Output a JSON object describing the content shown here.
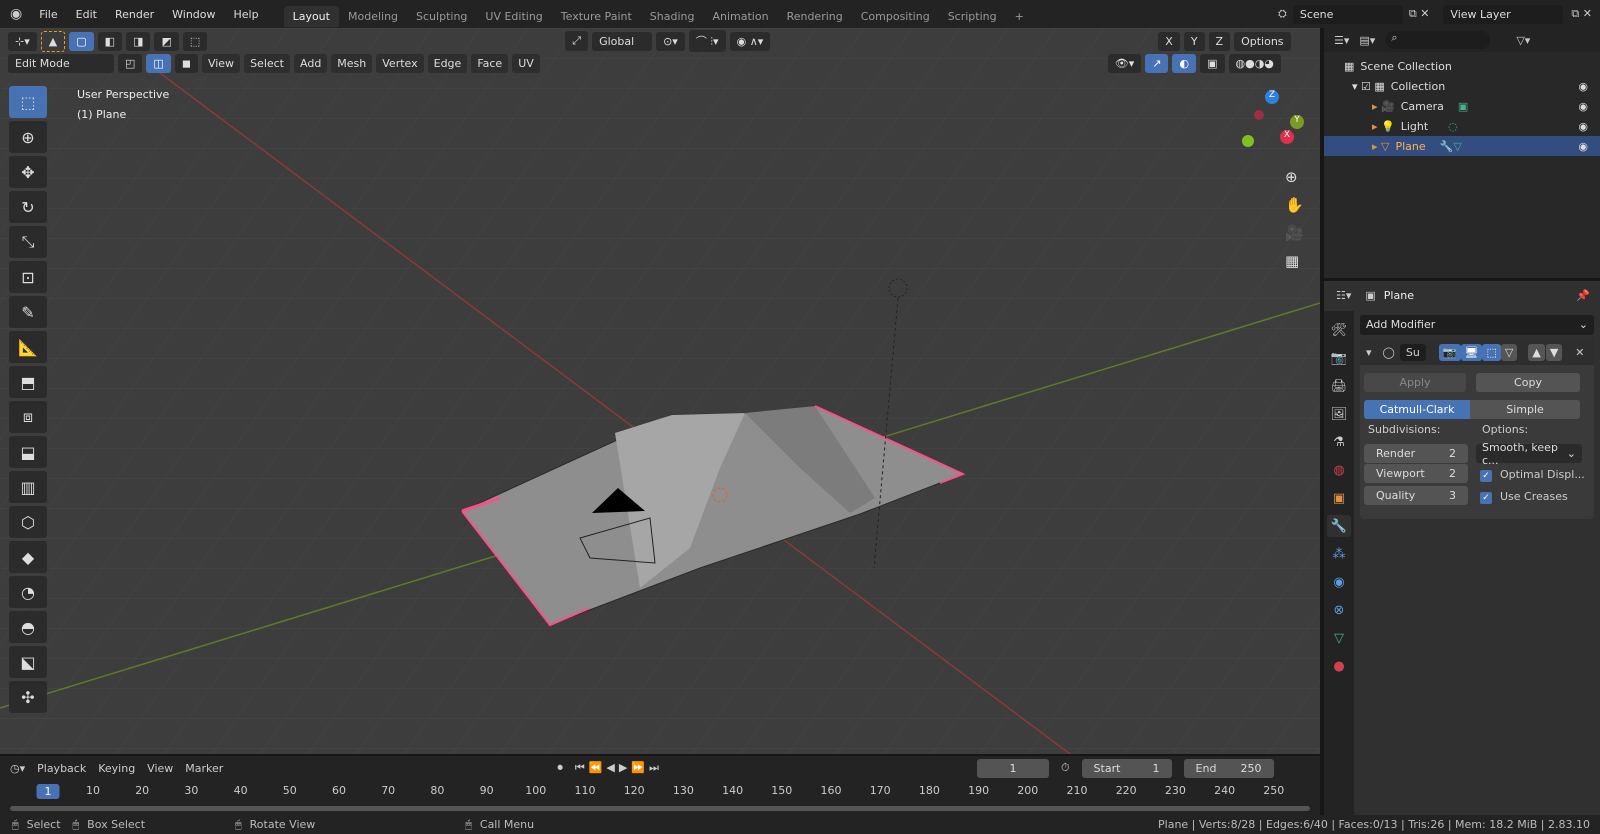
{
  "topbar": {
    "menus": [
      "File",
      "Edit",
      "Render",
      "Window",
      "Help"
    ],
    "tabs": [
      "Layout",
      "Modeling",
      "Sculpting",
      "UV Editing",
      "Texture Paint",
      "Shading",
      "Animation",
      "Rendering",
      "Compositing",
      "Scripting"
    ],
    "scene": "Scene",
    "view_layer": "View Layer"
  },
  "viewport": {
    "orientation": "Global",
    "options": "Options",
    "mode": "Edit Mode",
    "menus": [
      "View",
      "Select",
      "Add",
      "Mesh",
      "Vertex",
      "Edge",
      "Face",
      "UV"
    ],
    "overlay_title": "User Perspective",
    "overlay_object": "(1) Plane",
    "axes": [
      "X",
      "Y",
      "Z"
    ]
  },
  "outliner": {
    "root": "Scene Collection",
    "collection": "Collection",
    "items": [
      "Camera",
      "Light",
      "Plane"
    ]
  },
  "properties": {
    "object": "Plane",
    "add_modifier": "Add Modifier",
    "modifier_name": "Su",
    "apply": "Apply",
    "copy": "Copy",
    "types": [
      "Catmull-Clark",
      "Simple"
    ],
    "subdivisions_label": "Subdivisions:",
    "options_label": "Options:",
    "render_label": "Render",
    "render_value": "2",
    "viewport_label": "Viewport",
    "viewport_value": "2",
    "quality_label": "Quality",
    "quality_value": "3",
    "uv_smooth": "Smooth, keep c...",
    "optimal_display": "Optimal Displ...",
    "use_creases": "Use Creases"
  },
  "timeline": {
    "menus": [
      "Playback",
      "Keying",
      "View",
      "Marker"
    ],
    "current_frame": "1",
    "start_label": "Start",
    "start": "1",
    "end_label": "End",
    "end": "250",
    "ticks": [
      "1",
      "10",
      "20",
      "30",
      "40",
      "50",
      "60",
      "70",
      "80",
      "90",
      "100",
      "110",
      "120",
      "130",
      "140",
      "150",
      "160",
      "170",
      "180",
      "190",
      "200",
      "210",
      "220",
      "230",
      "240",
      "250"
    ]
  },
  "status": {
    "select": "Select",
    "box_select": "Box Select",
    "rotate": "Rotate View",
    "call_menu": "Call Menu",
    "stats": "Plane | Verts:8/28 | Edges:6/40 | Faces:0/13 | Tris:26 | Mem: 18.2 MiB | 2.83.10"
  }
}
